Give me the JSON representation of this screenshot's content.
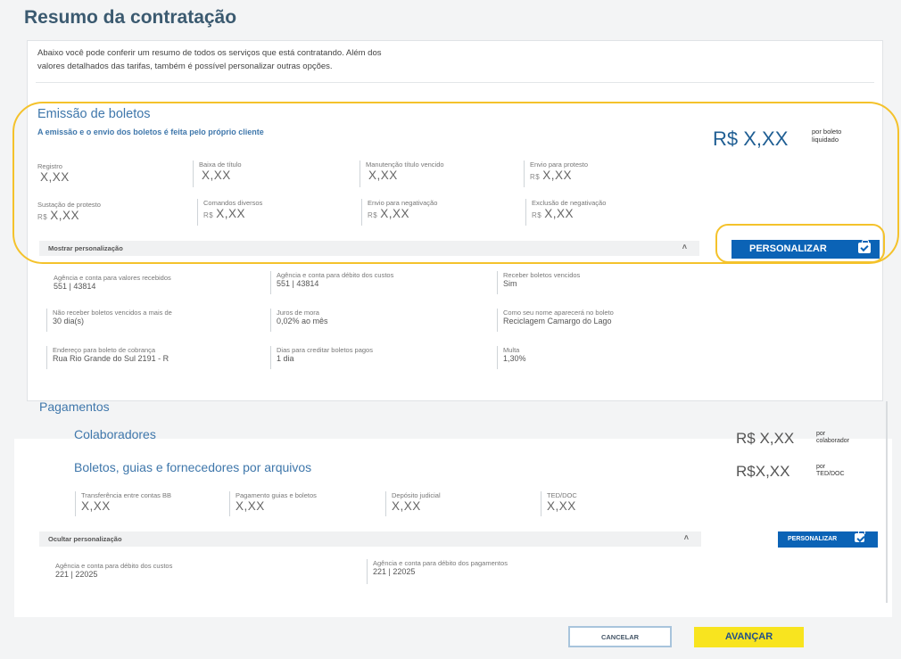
{
  "page": {
    "title": "Resumo da contratação"
  },
  "intro": {
    "line1": "Abaixo você pode conferir um resumo de todos os serviços que está contratando. Além dos",
    "line2": "valores detalhados das tarifas, também é possível personalizar outras opções."
  },
  "emissao": {
    "title": "Emissão de boletos",
    "subtitle": "A emissão e o envio dos boletos é feita pelo próprio cliente",
    "price": "R$ X,XX",
    "price_note_1": "por boleto",
    "price_note_2": "liquidado",
    "fees": [
      {
        "label": "Registro",
        "currency": "",
        "value": "X,XX"
      },
      {
        "label": "Baixa de título",
        "currency": "",
        "value": "X,XX"
      },
      {
        "label": "Manutenção título vencido",
        "currency": "",
        "value": "X,XX"
      },
      {
        "label": "Envio para protesto",
        "currency": "R$",
        "value": "X,XX"
      },
      {
        "label": "Sustação de protesto",
        "currency": "R$",
        "value": "X,XX"
      },
      {
        "label": "Comandos diversos",
        "currency": "R$",
        "value": "X,XX"
      },
      {
        "label": "Envio para negativação",
        "currency": "R$",
        "value": "X,XX"
      },
      {
        "label": "Exclusão de negativação",
        "currency": "R$",
        "value": "X,XX"
      }
    ],
    "toggle_label": "Mostrar personalização",
    "personalizar_label": "PERSONALIZAR",
    "options": [
      {
        "label": "Agência e conta para valores recebidos",
        "value": "551 | 43814"
      },
      {
        "label": "Agência e conta para débito dos custos",
        "value": "551 | 43814"
      },
      {
        "label": "Receber boletos vencidos",
        "value": "Sim"
      },
      {
        "label": "Não receber boletos vencidos a mais de",
        "value": "30 dia(s)"
      },
      {
        "label": "Juros de mora",
        "value": "0,02% ao mês"
      },
      {
        "label": "Como seu nome aparecerá no boleto",
        "value": "Reciclagem Camargo do Lago"
      },
      {
        "label": "Endereço para boleto de cobrança",
        "value": "Rua Rio Grande do Sul 2191 - R"
      },
      {
        "label": "Dias para creditar boletos pagos",
        "value": "1 dia"
      },
      {
        "label": "Multa",
        "value": "1,30%"
      }
    ]
  },
  "pagamentos": {
    "title": "Pagamentos",
    "colaboradores_title": "Colaboradores",
    "colaboradores_price": "R$ X,XX",
    "colaboradores_note_1": "por",
    "colaboradores_note_2": "colaborador",
    "boletos_title": "Boletos, guias e fornecedores por arquivos",
    "boletos_price": "R$X,XX",
    "boletos_note_1": "por",
    "boletos_note_2": "TED/DOC",
    "fees": [
      {
        "label": "Transferência entre contas BB",
        "value": "X,XX"
      },
      {
        "label": "Pagamento guias e boletos",
        "value": "X,XX"
      },
      {
        "label": "Depósito judicial",
        "value": "X,XX"
      },
      {
        "label": "TED/DOC",
        "value": "X,XX"
      }
    ],
    "toggle_label": "Ocultar personalização",
    "personalizar_label": "PERSONALIZAR",
    "options": [
      {
        "label": "Agência e conta para débito dos custos",
        "value": "221 | 22025"
      },
      {
        "label": "Agência e conta para débito dos pagamentos",
        "value": "221 | 22025"
      }
    ]
  },
  "footer": {
    "cancel_label": "CANCELAR",
    "next_label": "AVANÇAR"
  }
}
